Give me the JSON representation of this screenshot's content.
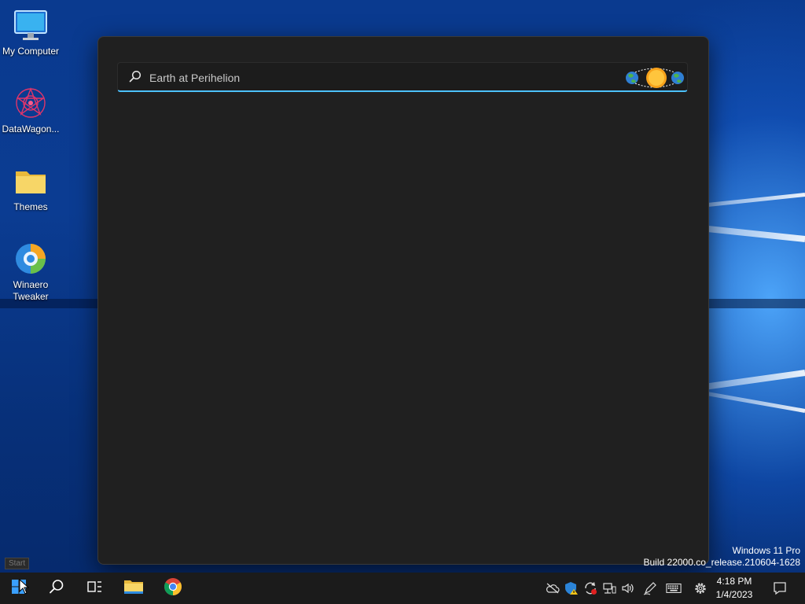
{
  "desktop": {
    "icons": [
      {
        "label": "My Computer",
        "icon": "monitor-icon"
      },
      {
        "label": "DataWagon...",
        "icon": "datawagon-icon"
      },
      {
        "label": "Themes",
        "icon": "folder-icon"
      },
      {
        "label": "Winaero Tweaker",
        "icon": "winaero-tweaker-icon"
      }
    ],
    "watermark": {
      "line1": "Windows 11 Pro",
      "line2": "Build 22000.co_release.210604-1628"
    },
    "start_tooltip": "Start"
  },
  "search": {
    "placeholder": "Earth at Perihelion",
    "value": "",
    "highlight_icon": "earth-sun-perihelion-icon",
    "accent_color": "#4cc2ff"
  },
  "taskbar": {
    "buttons": [
      {
        "name": "start",
        "icon": "windows-logo-icon"
      },
      {
        "name": "search",
        "icon": "search-icon"
      },
      {
        "name": "task-view",
        "icon": "task-view-icon"
      },
      {
        "name": "file-explorer",
        "icon": "folder-icon"
      },
      {
        "name": "chrome",
        "icon": "chrome-icon"
      }
    ],
    "tray": [
      "cloud-offline-icon",
      "security-warning-icon",
      "sync-icon",
      "network-icon",
      "volume-icon",
      "pen-icon",
      "keyboard-icon",
      "settings-gear-icon"
    ],
    "clock": {
      "time": "4:18 PM",
      "date": "1/4/2023"
    },
    "notification_icon": "notification-icon"
  }
}
